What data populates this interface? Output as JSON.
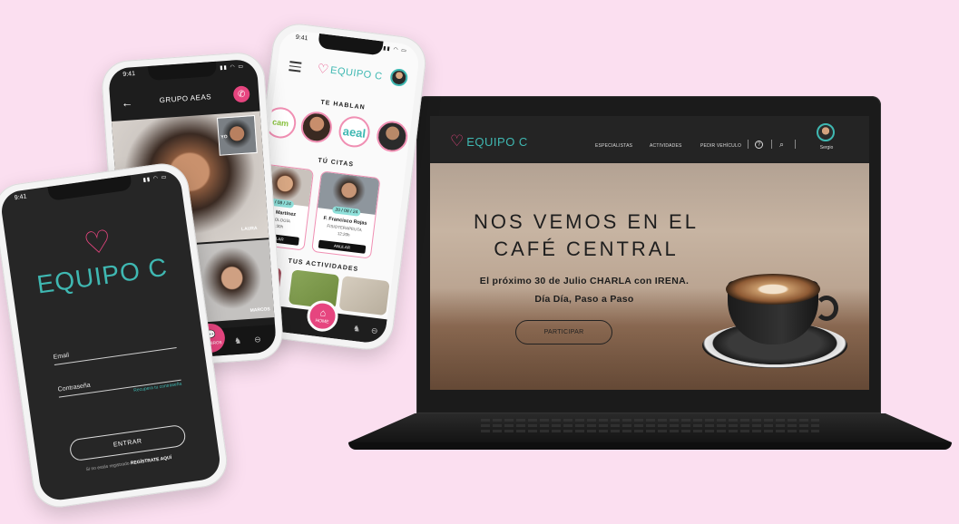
{
  "brand": {
    "name": "EQUIPO C",
    "heart_color": "#e6457f",
    "text_color": "#3fb8b2",
    "background": "#fbdff0"
  },
  "status_time": "9:41",
  "login_screen": {
    "email_label": "Email",
    "password_label": "Contraseña",
    "forgot_link": "Recupera tu contraseña",
    "enter_button": "ENTRAR",
    "register_prompt": "Si no estás registrado",
    "register_link": "REGÍSTRATE AQUÍ"
  },
  "group_screen": {
    "title": "GRUPO AEAS",
    "self_label": "YO",
    "main_label": "LAURA",
    "tile_label": "MARCOS",
    "chat_button": "MIEMBROS"
  },
  "home_screen": {
    "talking_title": "TE HABLAN",
    "talking": [
      {
        "name": "cam",
        "type": "logo"
      },
      {
        "name": "person-1",
        "type": "photo"
      },
      {
        "name": "aeal",
        "type": "logo"
      },
      {
        "name": "person-2",
        "type": "photo"
      }
    ],
    "appointments_title": "TÚ CITAS",
    "appointments": [
      {
        "date": "15 / 08 / 24",
        "name": "Lucía Martínez",
        "role": "PSICOLOGÍA",
        "time": "10:30h",
        "action": "ANULAR"
      },
      {
        "date": "20 / 08 / 24",
        "name": "F. Francisco Rojas",
        "role": "FISIOTERAPEUTA",
        "time": "12:20h",
        "action": "ANULAR"
      }
    ],
    "activities_title": "TUS ACTIVIDADES",
    "home_button": "HOME"
  },
  "web": {
    "menu": [
      "ESPECIALISTAS",
      "ACTIVIDADES",
      "PEDIR VEHÍCULO"
    ],
    "user_name": "Sergio",
    "hero_title": "NOS VEMOS EN EL CAFÉ CENTRAL",
    "hero_line1": "El próximo 30 de Julio CHARLA con IRENA.",
    "hero_line2": "Día Día, Paso a Paso",
    "cta_label": "PARTICIPAR"
  },
  "icons": {
    "back": "←",
    "call": "✆",
    "home": "⌂",
    "chat": "💬",
    "search": "⌕",
    "help": "?",
    "car": "⊖",
    "activity": "♞"
  }
}
